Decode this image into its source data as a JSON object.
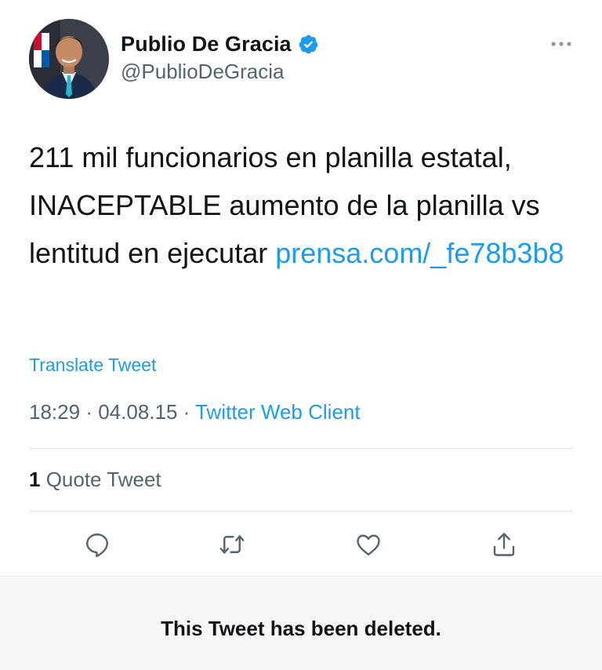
{
  "author": {
    "display_name": "Publio De Gracia",
    "handle": "@PublioDeGracia",
    "verified": true,
    "verified_color": "#1d9bf0"
  },
  "tweet": {
    "text_plain": "211 mil funcionarios en planilla estatal, INACEPTABLE aumento de la planilla vs lentitud en ejecutar ",
    "link_text": "prensa.com/_fe78b3b8",
    "translate_label": "Translate Tweet",
    "time": "18:29",
    "date": "04.08.15",
    "separator": "·",
    "source": "Twitter Web Client"
  },
  "stats": {
    "quote_count": "1",
    "quote_label": " Quote Tweet"
  },
  "actions": [
    {
      "icon": "reply-icon"
    },
    {
      "icon": "retweet-icon"
    },
    {
      "icon": "like-icon"
    },
    {
      "icon": "share-icon"
    }
  ],
  "menu": {
    "icon": "more-icon"
  },
  "deleted_notice": "This Tweet has been deleted.",
  "colors": {
    "link": "#1d9bf0",
    "secondary_text": "#536471",
    "primary_text": "#0f1419",
    "deleted_bg": "#f7f9f9"
  }
}
